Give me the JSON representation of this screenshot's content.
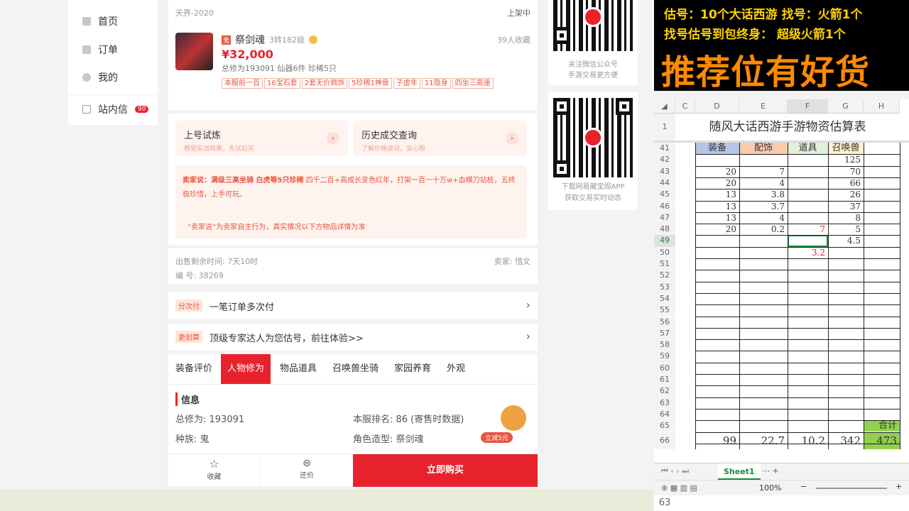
{
  "nav": {
    "items": [
      {
        "label": "首页",
        "icon": "home-icon"
      },
      {
        "label": "订单",
        "icon": "order-icon"
      },
      {
        "label": "我的",
        "icon": "user-icon"
      }
    ],
    "inbox": {
      "label": "站内信",
      "badge": "90",
      "icon": "mail-icon"
    }
  },
  "listing": {
    "server": "天界-2020",
    "status": "上架中",
    "name": "祭剑魂",
    "level": "3转182级",
    "fav": "39人收藏",
    "price": "¥32,000",
    "stats": "总修为193091  仙器6件  珍稀5只",
    "tags": [
      "本服前一百",
      "16宝石套",
      "2套无价佩饰",
      "5珍稀1神兽",
      "子虚年",
      "11隐身",
      "四坐三高速"
    ]
  },
  "actions": {
    "trial": {
      "title": "上号试炼",
      "sub": "感受实战效果，先试后买"
    },
    "history": {
      "title": "历史成交查询",
      "sub": "了解价格波动，安心购"
    }
  },
  "seller": {
    "highlight": "卖家说：满级三高坐骑 白虎等5只珍稀",
    "text": " 四千二百+高成长变色红年，打架一百一十万w+血横刀站桩，五终极珍惜，上手可玩。",
    "disclaimer": "“卖家说”为卖家自主行为，真实情况以下方物品详情为准"
  },
  "meta": {
    "remaining": "出售剩余时间: 7天10时",
    "seller": "卖家: 惜文",
    "number": "编 号: 38269"
  },
  "rows": [
    {
      "badge": "分次付",
      "text": "一笔订单多次付"
    },
    {
      "badge": "更划算",
      "text": "顶级专家达人为您估号，前往体验>>"
    }
  ],
  "tabs": [
    "装备评价",
    "人物修为",
    "物品道具",
    "召唤兽坐骑",
    "家园养育",
    "外观"
  ],
  "info": {
    "title": "信息",
    "left": [
      "总修为: 193091",
      "种族: 鬼"
    ],
    "right": [
      "本服排名: 86 (寄售时数据)",
      "角色造型: 祭剑魂"
    ],
    "promo": "立减5元"
  },
  "footer": {
    "fav": "收藏",
    "bargain": "还价",
    "buy": "立即购买"
  },
  "qr": [
    {
      "caption1": "关注微信公众号",
      "caption2": "手游交易更方便"
    },
    {
      "caption1": "下载网易藏宝阁APP",
      "caption2": "获取交易实时动态"
    }
  ],
  "banner": {
    "line1": "估号：10个大话西游 找号：火箭1个",
    "line2": "找号估号到包终身： 超级火箭1个",
    "line3": "推荐位有好货"
  },
  "sheet": {
    "title": "随风大话西游手游物资估算表",
    "cols": [
      "C",
      "D",
      "E",
      "F",
      "G",
      "H"
    ],
    "headers": [
      "装备",
      "配饰",
      "道具",
      "召唤兽"
    ],
    "rows": [
      {
        "n": "41",
        "v": [
          "",
          "",
          "",
          ""
        ]
      },
      {
        "n": "42",
        "v": [
          "",
          "",
          "",
          "125"
        ]
      },
      {
        "n": "43",
        "v": [
          "20",
          "7",
          "",
          "70"
        ]
      },
      {
        "n": "44",
        "v": [
          "20",
          "4",
          "",
          "66"
        ]
      },
      {
        "n": "45",
        "v": [
          "13",
          "3.8",
          "",
          "26"
        ]
      },
      {
        "n": "46",
        "v": [
          "13",
          "3.7",
          "",
          "37"
        ]
      },
      {
        "n": "47",
        "v": [
          "13",
          "4",
          "",
          "8"
        ]
      },
      {
        "n": "48",
        "v": [
          "20",
          "0.2",
          "7",
          "5"
        ]
      },
      {
        "n": "49",
        "v": [
          "",
          "",
          "",
          "4.5"
        ]
      },
      {
        "n": "50",
        "v": [
          "",
          "",
          "3.2",
          ""
        ]
      }
    ],
    "empty_rows": [
      "51",
      "52",
      "53",
      "54",
      "55",
      "56",
      "57",
      "58",
      "59",
      "60",
      "61",
      "62",
      "63",
      "64"
    ],
    "row65": "65",
    "total_label": "合计",
    "row66": "66",
    "totals": [
      "99",
      "22.7",
      "10.2",
      "342",
      "473"
    ],
    "sheet_tab": "Sheet1",
    "zoom": "100%",
    "row_extra": "63"
  }
}
